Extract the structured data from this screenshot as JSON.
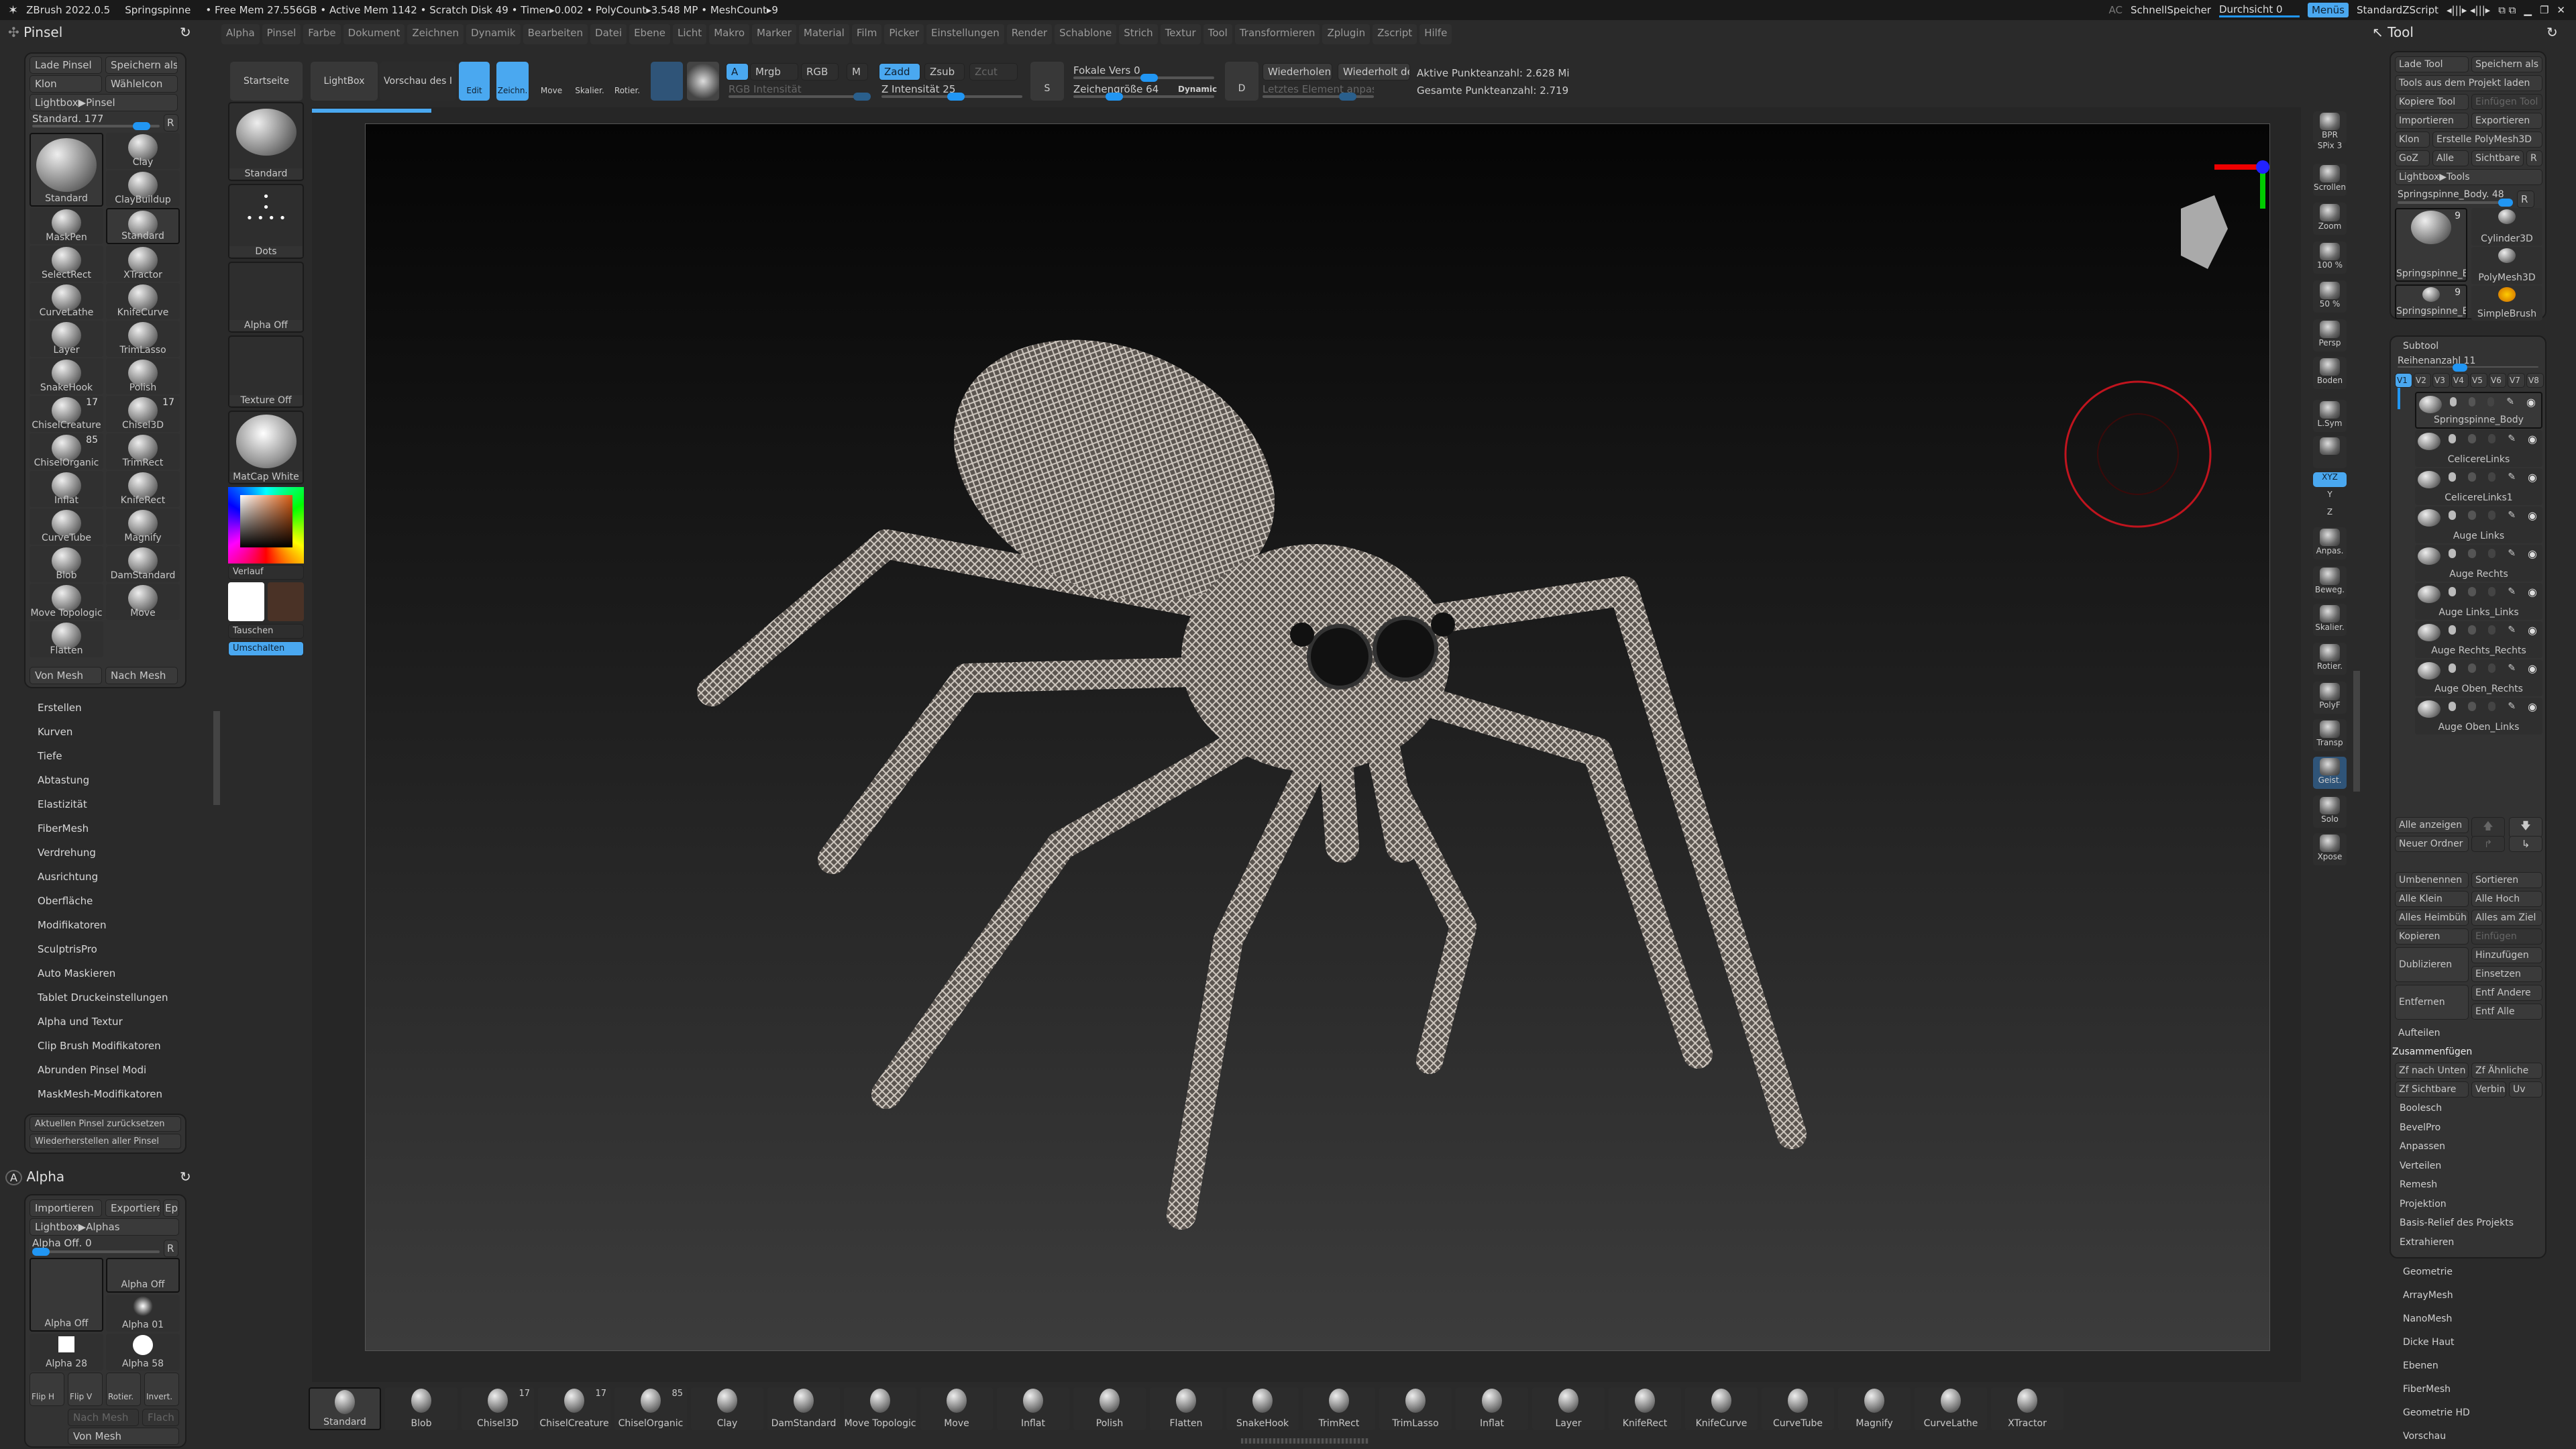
{
  "titlebar": {
    "app": "ZBrush 2022.0.5",
    "project": "Springspinne",
    "stats": "• Free Mem 27.556GB • Active Mem 1142 • Scratch Disk 49 •  Timer▸0.002 • PolyCount▸3.548 MP  • MeshCount▸9",
    "ac": "AC",
    "quicksave": "SchnellSpeicher",
    "transparency": "Durchsicht 0",
    "menus": "Menüs",
    "zscript": "StandardZScript"
  },
  "menubar": [
    "Alpha",
    "Pinsel",
    "Farbe",
    "Dokument",
    "Zeichnen",
    "Dynamik",
    "Bearbeiten",
    "Datei",
    "Ebene",
    "Licht",
    "Makro",
    "Marker",
    "Material",
    "Film",
    "Picker",
    "Einstellungen",
    "Render",
    "Schablone",
    "Strich",
    "Textur",
    "Tool",
    "Transformieren",
    "Zplugin",
    "Zscript",
    "Hilfe"
  ],
  "pinsel": {
    "title": "Pinsel",
    "load": "Lade Pinsel",
    "save_as": "Speichern als",
    "clone": "Klon",
    "select_icon": "WähleIcon",
    "lightbox": "Lightbox▶Pinsel",
    "slider": "Standard. 177",
    "slider_value": 177,
    "r": "R",
    "brushes": [
      {
        "label": "Standard",
        "big": true,
        "sel": true
      },
      {
        "label": "Clay"
      },
      {
        "label": "ClayBuildup"
      },
      {
        "label": "MaskPen"
      },
      {
        "label": "Standard",
        "sel": true
      },
      {
        "label": "SelectRect"
      },
      {
        "label": "XTractor"
      },
      {
        "label": "CurveLathe"
      },
      {
        "label": "KnifeCurve"
      },
      {
        "label": "Layer"
      },
      {
        "label": "TrimLasso"
      },
      {
        "label": "SnakeHook"
      },
      {
        "label": "Polish"
      },
      {
        "label": "ChiselCreature",
        "badge": "17"
      },
      {
        "label": "Chisel3D",
        "badge": "17"
      },
      {
        "label": "ChiselOrganic",
        "badge": "85"
      },
      {
        "label": "TrimRect"
      },
      {
        "label": "Inflat"
      },
      {
        "label": "KnifeRect"
      },
      {
        "label": "CurveTube"
      },
      {
        "label": "Magnify"
      },
      {
        "label": "Blob"
      },
      {
        "label": "DamStandard"
      },
      {
        "label": "Move Topologic"
      },
      {
        "label": "Move"
      },
      {
        "label": "Flatten"
      }
    ],
    "from_mesh": "Von Mesh",
    "to_mesh": "Nach Mesh",
    "sections": [
      "Erstellen",
      "Kurven",
      "Tiefe",
      "Abtastung",
      "Elastizität",
      "FiberMesh",
      "Verdrehung",
      "Ausrichtung",
      "Oberfläche",
      "Modifikatoren",
      "SculptrisPro",
      "Auto Maskieren",
      "Tablet Druckeinstellungen",
      "Alpha und Textur",
      "Clip Brush Modifikatoren",
      "Abrunden Pinsel Modi",
      "MaskMesh-Modifikatoren"
    ],
    "reset": "Aktuellen Pinsel zurücksetzen",
    "restore": "Wiederherstellen aller Pinsel"
  },
  "alpha": {
    "title": "Alpha",
    "import": "Importieren",
    "export": "Exportiere",
    "ep": "Ep",
    "lightbox": "Lightbox▶Alphas",
    "slider": "Alpha Off. 0",
    "r": "R",
    "items": [
      "Alpha Off",
      "Alpha Off",
      "Alpha 01",
      "Alpha 28",
      "Alpha 58"
    ],
    "flip_h": "Flip H",
    "flip_v": "Flip V",
    "rotate": "Rotier.",
    "invert": "Invert.",
    "to_mesh": "Nach Mesh",
    "flat": "Flach",
    "from_mesh": "Von Mesh"
  },
  "column": {
    "brush": "Standard",
    "stroke": "Dots",
    "alpha": "Alpha Off",
    "texture": "Texture Off",
    "material": "MatCap White",
    "gradient": "Verlauf",
    "swap": "Tauschen",
    "toggle": "Umschalten",
    "main_color": "#ffffff",
    "secondary_color": "#4a3226"
  },
  "toolbar": {
    "home": "Startseite",
    "lightbox": "LightBox",
    "preview": "Vorschau des I",
    "edit": "Edit",
    "draw": "Zeichn.",
    "move": "Move",
    "scale": "Skalier.",
    "rotate": "Rotier.",
    "a": "A",
    "mrgb": "Mrgb",
    "rgb": "RGB",
    "m": "M",
    "zadd": "Zadd",
    "zsub": "Zsub",
    "zcut": "Zcut",
    "rgb_intensity": "RGB Intensität",
    "z_intensity": "Z Intensität 25",
    "focal": "Fokale Vers 0",
    "draw_size": "Zeichengröße 64",
    "dynamic": "Dynamic",
    "s": "S",
    "d": "D",
    "repeat": "Wiederholen",
    "repeat_last": "Wiederholt de",
    "adjust_last": "Letztes Element anpassen",
    "active_points": "Aktive Punkteanzahl: 2.628 Mi",
    "total_points": "Gesamte Punkteanzahl: 2.719",
    "load_progress": 0.06
  },
  "right_toolbar": [
    "BPR",
    "SPix 3",
    "Scrollen",
    "Zoom",
    "100 %",
    "50 %",
    "Persp",
    "Boden",
    "L.Sym",
    "",
    "XYZ",
    "Y",
    "Z",
    "Anpas.",
    "Beweg.",
    "Skalier.",
    "Rotier.",
    "PolyF",
    "Transp",
    "Geist.",
    "Solo",
    "Xpose"
  ],
  "tool": {
    "title": "Tool",
    "buttons": [
      "Lade Tool",
      "Speichern als",
      "Tools aus dem Projekt laden",
      "Kopiere Tool",
      "Einfügen Tool",
      "Importieren",
      "Exportieren",
      "Klon",
      "Erstelle PolyMesh3D",
      "GoZ",
      "Alle",
      "Sichtbare",
      "R",
      "Lightbox▶Tools"
    ],
    "slider": "Springspinne_Body. 48",
    "r": "R",
    "thumbs": [
      {
        "label": "Springspinne_B",
        "badge": "9"
      },
      {
        "label": "Cylinder3D"
      },
      {
        "label": "PolyMesh3D"
      },
      {
        "label": "Springspinne_B",
        "badge": "9"
      },
      {
        "label": "SimpleBrush"
      }
    ],
    "subtool": {
      "title": "Subtool",
      "rows": "Reihenanzahl 11",
      "versions": [
        "V1",
        "V2",
        "V3",
        "V4",
        "V5",
        "V6",
        "V7",
        "V8"
      ],
      "items": [
        "Springspinne_Body",
        "CelicereLinks",
        "CelicereLinks1",
        "Auge Links",
        "Auge Rechts",
        "Auge Links_Links",
        "Auge Rechts_Rechts",
        "Auge Oben_Rechts",
        "Auge Oben_Links"
      ],
      "show_all": "Alle anzeigen",
      "new_folder": "Neuer Ordner",
      "rename": "Umbenennen",
      "sort": "Sortieren",
      "all_low": "Alle Klein",
      "all_high": "Alle Hoch",
      "all_home": "Alles Heimbüh",
      "all_target": "Alles am Ziel",
      "copy": "Kopieren",
      "paste": "Einfügen",
      "duplicate": "Dublizieren",
      "add": "Hinzufügen",
      "insert": "Einsetzen",
      "delete": "Entfernen",
      "del_other": "Entf Andere",
      "del_all": "Entf Alle",
      "split": "Aufteilen",
      "merge": "Zusammenfügen",
      "merge_down": "Zf nach Unten",
      "merge_similar": "Zf Ähnliche",
      "merge_visible": "Zf Sichtbare",
      "weld": "Verbin",
      "uv": "Uv",
      "subsections": [
        "Boolesch",
        "BevelPro",
        "Anpassen",
        "Verteilen",
        "Remesh",
        "Projektion",
        "Basis-Relief des Projekts",
        "Extrahieren"
      ]
    },
    "sections": [
      "Geometrie",
      "ArrayMesh",
      "NanoMesh",
      "Dicke Haut",
      "Ebenen",
      "FiberMesh",
      "Geometrie HD",
      "Vorschau"
    ]
  },
  "shelf": [
    {
      "label": "Standard"
    },
    {
      "label": "Blob"
    },
    {
      "label": "Chisel3D",
      "badge": "17"
    },
    {
      "label": "ChiselCreature",
      "badge": "17"
    },
    {
      "label": "ChiselOrganic",
      "badge": "85"
    },
    {
      "label": "Clay"
    },
    {
      "label": "DamStandard"
    },
    {
      "label": "Move Topologic"
    },
    {
      "label": "Move"
    },
    {
      "label": "Inflat"
    },
    {
      "label": "Polish"
    },
    {
      "label": "Flatten"
    },
    {
      "label": "SnakeHook"
    },
    {
      "label": "TrimRect"
    },
    {
      "label": "TrimLasso"
    },
    {
      "label": "Inflat"
    },
    {
      "label": "Layer"
    },
    {
      "label": "KnifeRect"
    },
    {
      "label": "KnifeCurve"
    },
    {
      "label": "CurveTube"
    },
    {
      "label": "Magnify"
    },
    {
      "label": "CurveLathe"
    },
    {
      "label": "XTractor"
    }
  ],
  "colors": {
    "accent": "#4aa8f0",
    "cursor_ring": "#c0141e"
  }
}
